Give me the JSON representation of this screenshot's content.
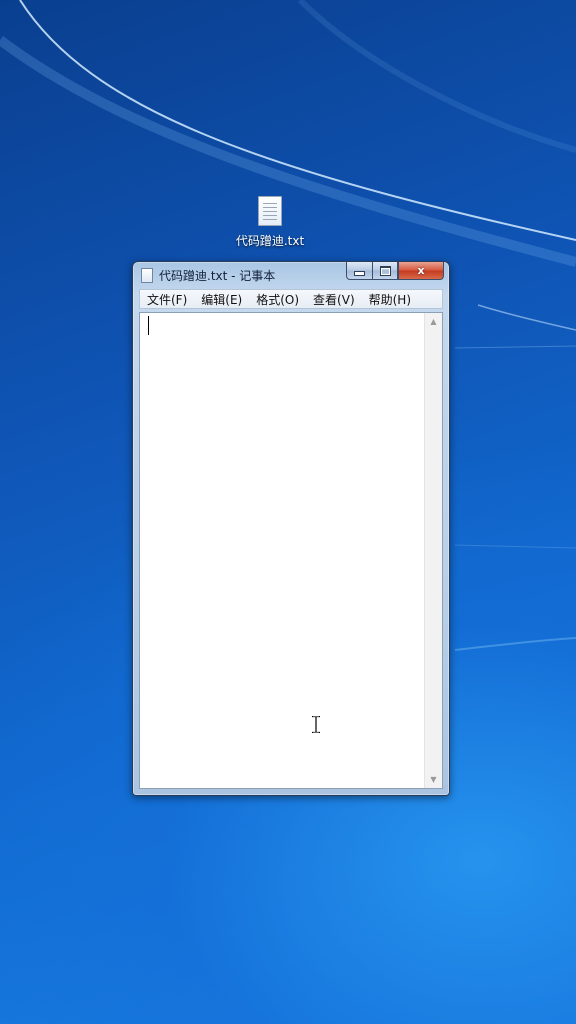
{
  "desktop": {
    "file_icon": "text-file-icon",
    "file_label": "代码蹭迪.txt"
  },
  "window": {
    "title": "代码蹭迪.txt - 记事本",
    "icon": "notepad-icon",
    "controls": {
      "minimize": "minimize-icon",
      "maximize": "maximize-icon",
      "close_glyph": "x"
    }
  },
  "menu": {
    "items": [
      {
        "label": "文件(F)"
      },
      {
        "label": "编辑(E)"
      },
      {
        "label": "格式(O)"
      },
      {
        "label": "查看(V)"
      },
      {
        "label": "帮助(H)"
      }
    ]
  },
  "editor": {
    "content": ""
  },
  "scrollbar": {
    "up_glyph": "▲",
    "down_glyph": "▼"
  },
  "colors": {
    "desktop_blue": "#0f54b4",
    "close_red": "#c43a1f",
    "window_frame": "#b9cfe8"
  }
}
